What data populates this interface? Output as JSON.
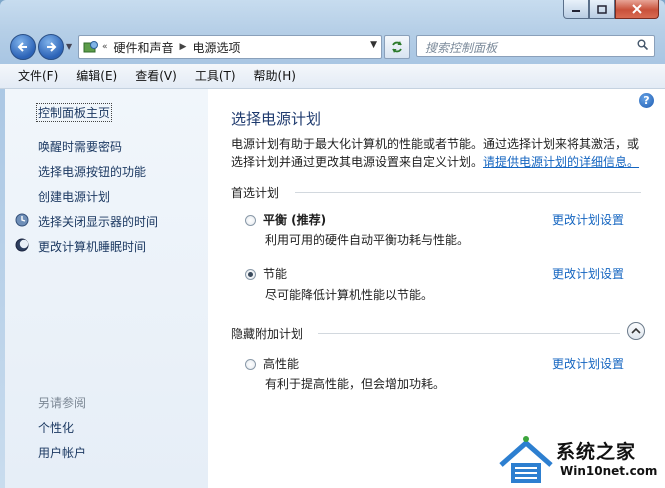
{
  "navigation": {
    "breadcrumbs": [
      "硬件和声音",
      "电源选项"
    ],
    "search_placeholder": "搜索控制面板"
  },
  "menu": [
    "文件(F)",
    "编辑(E)",
    "查看(V)",
    "工具(T)",
    "帮助(H)"
  ],
  "sidebar": {
    "home_link": "控制面板主页",
    "links": [
      "唤醒时需要密码",
      "选择电源按钮的功能",
      "创建电源计划",
      "选择关闭显示器的时间",
      "更改计算机睡眠时间"
    ],
    "see_also_header": "另请参阅",
    "see_also": [
      "个性化",
      "用户帐户"
    ]
  },
  "main": {
    "title": "选择电源计划",
    "description_line1": "电源计划有助于最大化计算机的性能或者节能。通过选择计划来将其激活，或",
    "description_line2_prefix": "选择计划并通过更改其电源设置来自定义计划。",
    "description_link": "请提供电源计划的详细信息。",
    "preferred_header": "首选计划",
    "hidden_header": "隐藏附加计划",
    "change_link": "更改计划设置",
    "plans": [
      {
        "name": "平衡 (推荐)",
        "description": "利用可用的硬件自动平衡功耗与性能。",
        "selected": false
      },
      {
        "name": "节能",
        "description": "尽可能降低计算机性能以节能。",
        "selected": true
      },
      {
        "name": "高性能",
        "description": "有利于提高性能，但会增加功耗。",
        "selected": false
      }
    ]
  },
  "watermark": {
    "title": "系统之家",
    "url": "Win10net.com"
  }
}
